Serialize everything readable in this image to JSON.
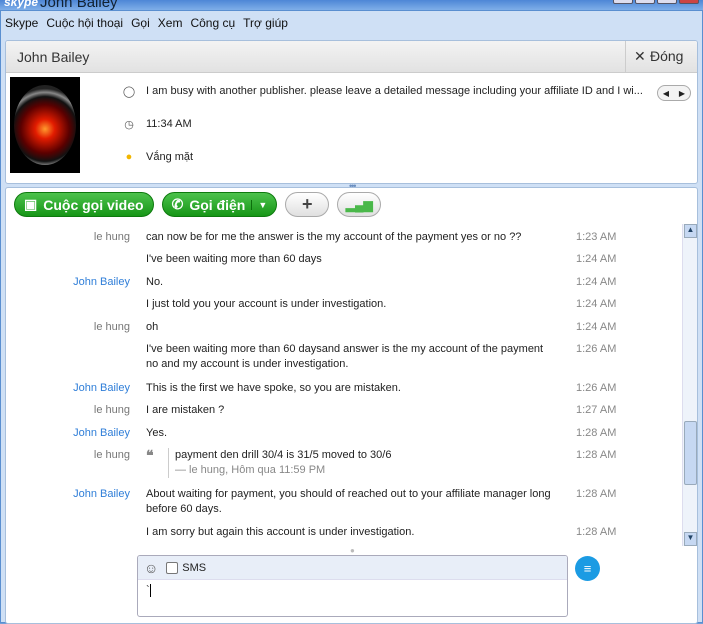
{
  "window": {
    "app": "skype",
    "title": "John Bailey"
  },
  "menu": [
    "Skype",
    "Cuộc hội thoại",
    "Gọi",
    "Xem",
    "Công cụ",
    "Trợ giúp"
  ],
  "contact": {
    "name": "John Bailey",
    "close_label": "Đóng",
    "mood": "I am busy with another publisher. please leave a detailed message including your affiliate ID and I wi...",
    "local_time": "11:34 AM",
    "status": "Vắng mặt"
  },
  "toolbar": {
    "video_call": "Cuộc gọi video",
    "call": "Gọi điện"
  },
  "messages": [
    {
      "sender": "le hung",
      "text": "can now be for me the answer is the my account of the payment yes  or no ??",
      "time": "1:23 AM"
    },
    {
      "sender": "",
      "text": "I've been waiting more than 60 days",
      "time": "1:24 AM"
    },
    {
      "sender": "John Bailey",
      "text": "No.",
      "time": "1:24 AM"
    },
    {
      "sender": "",
      "text": "I just told you your account is under investigation.",
      "time": "1:24 AM"
    },
    {
      "sender": "le hung",
      "text": "oh",
      "time": "1:24 AM"
    },
    {
      "sender": "",
      "text": "I've been waiting more than 60 daysand  answer is the my account of the payment no and my account is under investigation.",
      "time": "1:26 AM"
    },
    {
      "sender": "John Bailey",
      "text": "This is the first we have spoke, so you are mistaken.",
      "time": "1:26 AM"
    },
    {
      "sender": "le hung",
      "text": "I are mistaken ?",
      "time": "1:27 AM"
    },
    {
      "sender": "John Bailey",
      "text": "Yes.",
      "time": "1:28 AM"
    },
    {
      "sender": "le hung",
      "quote": "payment den drill 30/4 is 31/5 moved to 30/6",
      "quote_attr": "— le hung, Hôm qua 11:59 PM",
      "time": "1:28 AM"
    },
    {
      "sender": "John Bailey",
      "text": "About waiting for payment, you should of  reached out to your affiliate manager long before 60 days.",
      "time": "1:28 AM"
    },
    {
      "sender": "",
      "text": "I am sorry but again this account is under investigation.",
      "time": "1:28 AM"
    }
  ],
  "input": {
    "sms_label": "SMS",
    "value": "`"
  }
}
